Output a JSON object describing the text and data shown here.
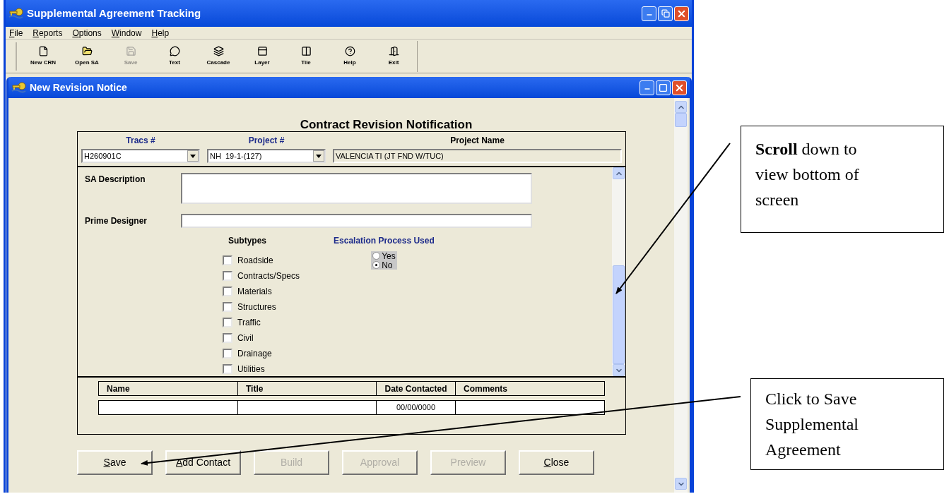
{
  "app": {
    "title": "Supplemental Agreement Tracking",
    "menu": [
      "File",
      "Reports",
      "Options",
      "Window",
      "Help"
    ],
    "toolbar": [
      {
        "kind": "new",
        "label": "New CRN",
        "disabled": false
      },
      {
        "kind": "open",
        "label": "Open SA",
        "disabled": false
      },
      {
        "kind": "save",
        "label": "Save",
        "disabled": true
      },
      {
        "kind": "text",
        "label": "Text",
        "disabled": false
      },
      {
        "kind": "cascade",
        "label": "Cascade",
        "disabled": false
      },
      {
        "kind": "layer",
        "label": "Layer",
        "disabled": false
      },
      {
        "kind": "tile",
        "label": "Tile",
        "disabled": false
      },
      {
        "kind": "help",
        "label": "Help",
        "disabled": false
      },
      {
        "kind": "exit",
        "label": "Exit",
        "disabled": false
      }
    ]
  },
  "child_window": {
    "title": "New Revision Notice",
    "form_title": "Contract Revision Notification",
    "header": [
      {
        "label": "Tracs #",
        "value": "H260901C",
        "kind": "dropdown"
      },
      {
        "label": "Project #",
        "value": "NH  19-1-(127)",
        "kind": "dropdown"
      },
      {
        "label": "Project Name",
        "value": "VALENCIA TI (JT FND W/TUC)",
        "kind": "readonly"
      }
    ],
    "sa_description": {
      "label": "SA Description"
    },
    "prime_designer": {
      "label": "Prime Designer"
    },
    "subtypes": {
      "heading": "Subtypes",
      "items": [
        {
          "label": "Roadside",
          "checked": false
        },
        {
          "label": "Contracts/Specs",
          "checked": false
        },
        {
          "label": "Materials",
          "checked": false
        },
        {
          "label": "Structures",
          "checked": false
        },
        {
          "label": "Traffic",
          "checked": false
        },
        {
          "label": "Civil",
          "checked": false
        },
        {
          "label": "Drainage",
          "checked": false
        },
        {
          "label": "Utilities",
          "checked": false
        }
      ]
    },
    "escalation": {
      "heading": "Escalation Process Used",
      "options": [
        {
          "label": "Yes",
          "selected": false
        },
        {
          "label": "No",
          "selected": true
        }
      ]
    },
    "contacts": {
      "columns": [
        "Name",
        "Title",
        "Date Contacted",
        "Comments"
      ],
      "rows": [
        [
          "",
          "",
          "00/00/0000",
          ""
        ]
      ]
    },
    "buttons": [
      {
        "label": "Save",
        "disabled": false
      },
      {
        "label": "Add Contact",
        "disabled": false
      },
      {
        "label": "Build",
        "disabled": true
      },
      {
        "label": "Approval",
        "disabled": true
      },
      {
        "label": "Preview",
        "disabled": true
      },
      {
        "label": "Close",
        "disabled": false
      }
    ]
  },
  "callouts": [
    {
      "text": "**Scroll** down to view bottom of screen"
    },
    {
      "text": "Click to Save Supplemental Agreement"
    }
  ]
}
